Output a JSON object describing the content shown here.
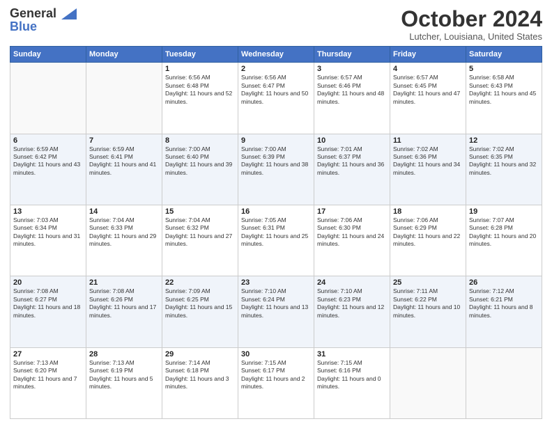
{
  "header": {
    "logo_line1": "General",
    "logo_line2": "Blue",
    "month": "October 2024",
    "location": "Lutcher, Louisiana, United States"
  },
  "weekdays": [
    "Sunday",
    "Monday",
    "Tuesday",
    "Wednesday",
    "Thursday",
    "Friday",
    "Saturday"
  ],
  "weeks": [
    [
      {
        "day": "",
        "text": ""
      },
      {
        "day": "",
        "text": ""
      },
      {
        "day": "1",
        "text": "Sunrise: 6:56 AM\nSunset: 6:48 PM\nDaylight: 11 hours and 52 minutes."
      },
      {
        "day": "2",
        "text": "Sunrise: 6:56 AM\nSunset: 6:47 PM\nDaylight: 11 hours and 50 minutes."
      },
      {
        "day": "3",
        "text": "Sunrise: 6:57 AM\nSunset: 6:46 PM\nDaylight: 11 hours and 48 minutes."
      },
      {
        "day": "4",
        "text": "Sunrise: 6:57 AM\nSunset: 6:45 PM\nDaylight: 11 hours and 47 minutes."
      },
      {
        "day": "5",
        "text": "Sunrise: 6:58 AM\nSunset: 6:43 PM\nDaylight: 11 hours and 45 minutes."
      }
    ],
    [
      {
        "day": "6",
        "text": "Sunrise: 6:59 AM\nSunset: 6:42 PM\nDaylight: 11 hours and 43 minutes."
      },
      {
        "day": "7",
        "text": "Sunrise: 6:59 AM\nSunset: 6:41 PM\nDaylight: 11 hours and 41 minutes."
      },
      {
        "day": "8",
        "text": "Sunrise: 7:00 AM\nSunset: 6:40 PM\nDaylight: 11 hours and 39 minutes."
      },
      {
        "day": "9",
        "text": "Sunrise: 7:00 AM\nSunset: 6:39 PM\nDaylight: 11 hours and 38 minutes."
      },
      {
        "day": "10",
        "text": "Sunrise: 7:01 AM\nSunset: 6:37 PM\nDaylight: 11 hours and 36 minutes."
      },
      {
        "day": "11",
        "text": "Sunrise: 7:02 AM\nSunset: 6:36 PM\nDaylight: 11 hours and 34 minutes."
      },
      {
        "day": "12",
        "text": "Sunrise: 7:02 AM\nSunset: 6:35 PM\nDaylight: 11 hours and 32 minutes."
      }
    ],
    [
      {
        "day": "13",
        "text": "Sunrise: 7:03 AM\nSunset: 6:34 PM\nDaylight: 11 hours and 31 minutes."
      },
      {
        "day": "14",
        "text": "Sunrise: 7:04 AM\nSunset: 6:33 PM\nDaylight: 11 hours and 29 minutes."
      },
      {
        "day": "15",
        "text": "Sunrise: 7:04 AM\nSunset: 6:32 PM\nDaylight: 11 hours and 27 minutes."
      },
      {
        "day": "16",
        "text": "Sunrise: 7:05 AM\nSunset: 6:31 PM\nDaylight: 11 hours and 25 minutes."
      },
      {
        "day": "17",
        "text": "Sunrise: 7:06 AM\nSunset: 6:30 PM\nDaylight: 11 hours and 24 minutes."
      },
      {
        "day": "18",
        "text": "Sunrise: 7:06 AM\nSunset: 6:29 PM\nDaylight: 11 hours and 22 minutes."
      },
      {
        "day": "19",
        "text": "Sunrise: 7:07 AM\nSunset: 6:28 PM\nDaylight: 11 hours and 20 minutes."
      }
    ],
    [
      {
        "day": "20",
        "text": "Sunrise: 7:08 AM\nSunset: 6:27 PM\nDaylight: 11 hours and 18 minutes."
      },
      {
        "day": "21",
        "text": "Sunrise: 7:08 AM\nSunset: 6:26 PM\nDaylight: 11 hours and 17 minutes."
      },
      {
        "day": "22",
        "text": "Sunrise: 7:09 AM\nSunset: 6:25 PM\nDaylight: 11 hours and 15 minutes."
      },
      {
        "day": "23",
        "text": "Sunrise: 7:10 AM\nSunset: 6:24 PM\nDaylight: 11 hours and 13 minutes."
      },
      {
        "day": "24",
        "text": "Sunrise: 7:10 AM\nSunset: 6:23 PM\nDaylight: 11 hours and 12 minutes."
      },
      {
        "day": "25",
        "text": "Sunrise: 7:11 AM\nSunset: 6:22 PM\nDaylight: 11 hours and 10 minutes."
      },
      {
        "day": "26",
        "text": "Sunrise: 7:12 AM\nSunset: 6:21 PM\nDaylight: 11 hours and 8 minutes."
      }
    ],
    [
      {
        "day": "27",
        "text": "Sunrise: 7:13 AM\nSunset: 6:20 PM\nDaylight: 11 hours and 7 minutes."
      },
      {
        "day": "28",
        "text": "Sunrise: 7:13 AM\nSunset: 6:19 PM\nDaylight: 11 hours and 5 minutes."
      },
      {
        "day": "29",
        "text": "Sunrise: 7:14 AM\nSunset: 6:18 PM\nDaylight: 11 hours and 3 minutes."
      },
      {
        "day": "30",
        "text": "Sunrise: 7:15 AM\nSunset: 6:17 PM\nDaylight: 11 hours and 2 minutes."
      },
      {
        "day": "31",
        "text": "Sunrise: 7:15 AM\nSunset: 6:16 PM\nDaylight: 11 hours and 0 minutes."
      },
      {
        "day": "",
        "text": ""
      },
      {
        "day": "",
        "text": ""
      }
    ]
  ]
}
